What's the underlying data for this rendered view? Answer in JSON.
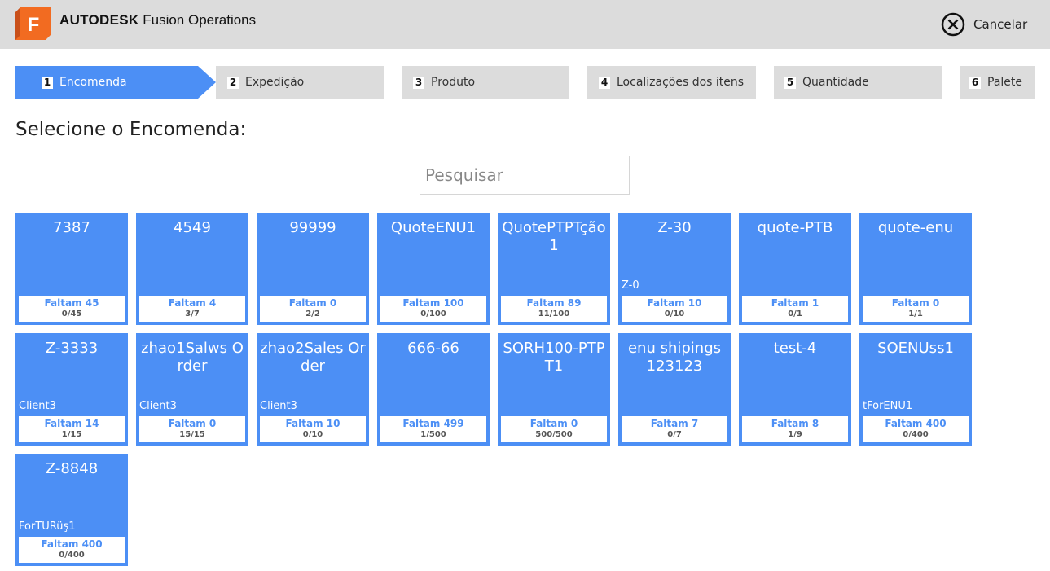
{
  "header": {
    "logo_letter": "F",
    "brand_bold": "AUTODESK",
    "brand_product": "Fusion Operations",
    "cancel_label": "Cancelar"
  },
  "colors": {
    "accent": "#4c8ff5",
    "topbar": "#dcdcdc",
    "logo_orange": "#f26b21"
  },
  "steps": [
    {
      "num": "1",
      "label": "Encomenda",
      "active": true
    },
    {
      "num": "2",
      "label": "Expedição",
      "active": false
    },
    {
      "num": "3",
      "label": "Produto",
      "active": false
    },
    {
      "num": "4",
      "label": "Localizações dos itens",
      "active": false
    },
    {
      "num": "5",
      "label": "Quantidade",
      "active": false
    },
    {
      "num": "6",
      "label": "Palete",
      "active": false
    }
  ],
  "page": {
    "heading": "Selecione o Encomenda:",
    "search_placeholder": "Pesquisar"
  },
  "orders": [
    {
      "name": "7387",
      "client": "",
      "remaining": "Faltam 45",
      "count": "0/45"
    },
    {
      "name": "4549",
      "client": "",
      "remaining": "Faltam 4",
      "count": "3/7"
    },
    {
      "name": "99999",
      "client": "",
      "remaining": "Faltam 0",
      "count": "2/2"
    },
    {
      "name": "QuoteENU1",
      "client": "",
      "remaining": "Faltam 100",
      "count": "0/100"
    },
    {
      "name": "QuotePTPTção1",
      "client": "",
      "remaining": "Faltam 89",
      "count": "11/100"
    },
    {
      "name": "Z-30",
      "client": "Z-0",
      "remaining": "Faltam 10",
      "count": "0/10"
    },
    {
      "name": "quote-PTB",
      "client": "",
      "remaining": "Faltam 1",
      "count": "0/1"
    },
    {
      "name": "quote-enu",
      "client": "",
      "remaining": "Faltam 0",
      "count": "1/1"
    },
    {
      "name": "Z-3333",
      "client": "Client3",
      "remaining": "Faltam 14",
      "count": "1/15"
    },
    {
      "name": "zhao1Salws Order",
      "client": "Client3",
      "remaining": "Faltam 0",
      "count": "15/15"
    },
    {
      "name": "zhao2Sales Order",
      "client": "Client3",
      "remaining": "Faltam 10",
      "count": "0/10"
    },
    {
      "name": "666-66",
      "client": "",
      "remaining": "Faltam 499",
      "count": "1/500"
    },
    {
      "name": "SORH100-PTPT1",
      "client": "",
      "remaining": "Faltam 0",
      "count": "500/500"
    },
    {
      "name": "enu shipings 123123",
      "client": "",
      "remaining": "Faltam 7",
      "count": "0/7"
    },
    {
      "name": "test-4",
      "client": "",
      "remaining": "Faltam 8",
      "count": "1/9"
    },
    {
      "name": "SOENUss1",
      "client": "tForENU1",
      "remaining": "Faltam 400",
      "count": "0/400"
    },
    {
      "name": "Z-8848",
      "client": "ForTURüş1",
      "remaining": "Faltam 400",
      "count": "0/400"
    }
  ]
}
